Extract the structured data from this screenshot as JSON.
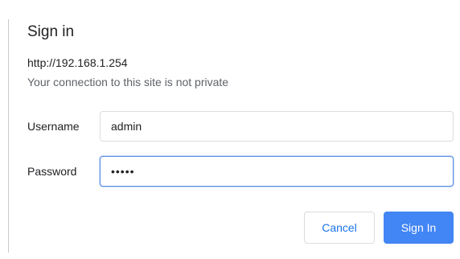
{
  "dialog": {
    "title": "Sign in",
    "origin": "http://192.168.1.254",
    "warning": "Your connection to this site is not private"
  },
  "form": {
    "username_label": "Username",
    "username_value": "admin",
    "password_label": "Password",
    "password_value": "•••••"
  },
  "buttons": {
    "cancel": "Cancel",
    "sign_in": "Sign In"
  },
  "colors": {
    "accent": "#4285f4",
    "link_text": "#1a73e8",
    "focus_border": "#5b8ee6"
  }
}
